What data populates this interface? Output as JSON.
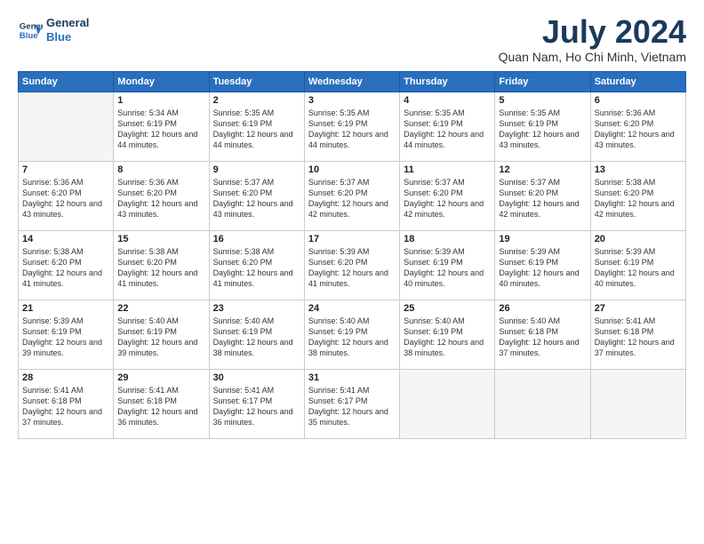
{
  "logo": {
    "line1": "General",
    "line2": "Blue"
  },
  "title": "July 2024",
  "location": "Quan Nam, Ho Chi Minh, Vietnam",
  "days_of_week": [
    "Sunday",
    "Monday",
    "Tuesday",
    "Wednesday",
    "Thursday",
    "Friday",
    "Saturday"
  ],
  "weeks": [
    [
      {
        "day": "",
        "sunrise": "",
        "sunset": "",
        "daylight": ""
      },
      {
        "day": "1",
        "sunrise": "Sunrise: 5:34 AM",
        "sunset": "Sunset: 6:19 PM",
        "daylight": "Daylight: 12 hours and 44 minutes."
      },
      {
        "day": "2",
        "sunrise": "Sunrise: 5:35 AM",
        "sunset": "Sunset: 6:19 PM",
        "daylight": "Daylight: 12 hours and 44 minutes."
      },
      {
        "day": "3",
        "sunrise": "Sunrise: 5:35 AM",
        "sunset": "Sunset: 6:19 PM",
        "daylight": "Daylight: 12 hours and 44 minutes."
      },
      {
        "day": "4",
        "sunrise": "Sunrise: 5:35 AM",
        "sunset": "Sunset: 6:19 PM",
        "daylight": "Daylight: 12 hours and 44 minutes."
      },
      {
        "day": "5",
        "sunrise": "Sunrise: 5:35 AM",
        "sunset": "Sunset: 6:19 PM",
        "daylight": "Daylight: 12 hours and 43 minutes."
      },
      {
        "day": "6",
        "sunrise": "Sunrise: 5:36 AM",
        "sunset": "Sunset: 6:20 PM",
        "daylight": "Daylight: 12 hours and 43 minutes."
      }
    ],
    [
      {
        "day": "7",
        "sunrise": "Sunrise: 5:36 AM",
        "sunset": "Sunset: 6:20 PM",
        "daylight": "Daylight: 12 hours and 43 minutes."
      },
      {
        "day": "8",
        "sunrise": "Sunrise: 5:36 AM",
        "sunset": "Sunset: 6:20 PM",
        "daylight": "Daylight: 12 hours and 43 minutes."
      },
      {
        "day": "9",
        "sunrise": "Sunrise: 5:37 AM",
        "sunset": "Sunset: 6:20 PM",
        "daylight": "Daylight: 12 hours and 43 minutes."
      },
      {
        "day": "10",
        "sunrise": "Sunrise: 5:37 AM",
        "sunset": "Sunset: 6:20 PM",
        "daylight": "Daylight: 12 hours and 42 minutes."
      },
      {
        "day": "11",
        "sunrise": "Sunrise: 5:37 AM",
        "sunset": "Sunset: 6:20 PM",
        "daylight": "Daylight: 12 hours and 42 minutes."
      },
      {
        "day": "12",
        "sunrise": "Sunrise: 5:37 AM",
        "sunset": "Sunset: 6:20 PM",
        "daylight": "Daylight: 12 hours and 42 minutes."
      },
      {
        "day": "13",
        "sunrise": "Sunrise: 5:38 AM",
        "sunset": "Sunset: 6:20 PM",
        "daylight": "Daylight: 12 hours and 42 minutes."
      }
    ],
    [
      {
        "day": "14",
        "sunrise": "Sunrise: 5:38 AM",
        "sunset": "Sunset: 6:20 PM",
        "daylight": "Daylight: 12 hours and 41 minutes."
      },
      {
        "day": "15",
        "sunrise": "Sunrise: 5:38 AM",
        "sunset": "Sunset: 6:20 PM",
        "daylight": "Daylight: 12 hours and 41 minutes."
      },
      {
        "day": "16",
        "sunrise": "Sunrise: 5:38 AM",
        "sunset": "Sunset: 6:20 PM",
        "daylight": "Daylight: 12 hours and 41 minutes."
      },
      {
        "day": "17",
        "sunrise": "Sunrise: 5:39 AM",
        "sunset": "Sunset: 6:20 PM",
        "daylight": "Daylight: 12 hours and 41 minutes."
      },
      {
        "day": "18",
        "sunrise": "Sunrise: 5:39 AM",
        "sunset": "Sunset: 6:19 PM",
        "daylight": "Daylight: 12 hours and 40 minutes."
      },
      {
        "day": "19",
        "sunrise": "Sunrise: 5:39 AM",
        "sunset": "Sunset: 6:19 PM",
        "daylight": "Daylight: 12 hours and 40 minutes."
      },
      {
        "day": "20",
        "sunrise": "Sunrise: 5:39 AM",
        "sunset": "Sunset: 6:19 PM",
        "daylight": "Daylight: 12 hours and 40 minutes."
      }
    ],
    [
      {
        "day": "21",
        "sunrise": "Sunrise: 5:39 AM",
        "sunset": "Sunset: 6:19 PM",
        "daylight": "Daylight: 12 hours and 39 minutes."
      },
      {
        "day": "22",
        "sunrise": "Sunrise: 5:40 AM",
        "sunset": "Sunset: 6:19 PM",
        "daylight": "Daylight: 12 hours and 39 minutes."
      },
      {
        "day": "23",
        "sunrise": "Sunrise: 5:40 AM",
        "sunset": "Sunset: 6:19 PM",
        "daylight": "Daylight: 12 hours and 38 minutes."
      },
      {
        "day": "24",
        "sunrise": "Sunrise: 5:40 AM",
        "sunset": "Sunset: 6:19 PM",
        "daylight": "Daylight: 12 hours and 38 minutes."
      },
      {
        "day": "25",
        "sunrise": "Sunrise: 5:40 AM",
        "sunset": "Sunset: 6:19 PM",
        "daylight": "Daylight: 12 hours and 38 minutes."
      },
      {
        "day": "26",
        "sunrise": "Sunrise: 5:40 AM",
        "sunset": "Sunset: 6:18 PM",
        "daylight": "Daylight: 12 hours and 37 minutes."
      },
      {
        "day": "27",
        "sunrise": "Sunrise: 5:41 AM",
        "sunset": "Sunset: 6:18 PM",
        "daylight": "Daylight: 12 hours and 37 minutes."
      }
    ],
    [
      {
        "day": "28",
        "sunrise": "Sunrise: 5:41 AM",
        "sunset": "Sunset: 6:18 PM",
        "daylight": "Daylight: 12 hours and 37 minutes."
      },
      {
        "day": "29",
        "sunrise": "Sunrise: 5:41 AM",
        "sunset": "Sunset: 6:18 PM",
        "daylight": "Daylight: 12 hours and 36 minutes."
      },
      {
        "day": "30",
        "sunrise": "Sunrise: 5:41 AM",
        "sunset": "Sunset: 6:17 PM",
        "daylight": "Daylight: 12 hours and 36 minutes."
      },
      {
        "day": "31",
        "sunrise": "Sunrise: 5:41 AM",
        "sunset": "Sunset: 6:17 PM",
        "daylight": "Daylight: 12 hours and 35 minutes."
      },
      {
        "day": "",
        "sunrise": "",
        "sunset": "",
        "daylight": ""
      },
      {
        "day": "",
        "sunrise": "",
        "sunset": "",
        "daylight": ""
      },
      {
        "day": "",
        "sunrise": "",
        "sunset": "",
        "daylight": ""
      }
    ]
  ]
}
